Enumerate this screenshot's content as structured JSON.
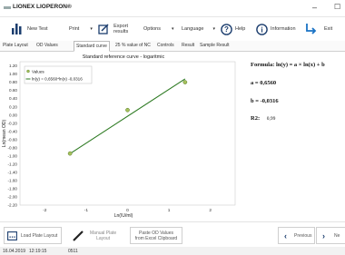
{
  "app": {
    "title": "LIONEX LIOPERON®"
  },
  "window": {
    "minimize_glyph": "–",
    "close_glyph": "☐"
  },
  "toolbar": {
    "new_test": "New Test",
    "print": "Print",
    "export_line1": "Export",
    "export_line2": "results",
    "options": "Options",
    "language": "Language",
    "help": "Help",
    "information": "Information",
    "exit": "Exit"
  },
  "tabs": [
    "Plate Layout",
    "OD Values",
    "Standard curve",
    "25 % value of NC",
    "Controls",
    "Result",
    "Sample Result"
  ],
  "active_tab": 2,
  "chart_data": {
    "type": "scatter",
    "title": "Standard reference curve - logaritmic",
    "xlabel": "Ln(IU/ml)",
    "ylabel": "Ln(mean OD)",
    "xlim": [
      -2.6,
      2.6
    ],
    "ylim": [
      -2.2,
      1.3
    ],
    "xticks": [
      -2,
      -1,
      0,
      1,
      2
    ],
    "yticks": [
      "1.20",
      "1.00",
      "0.80",
      "0.60",
      "0.40",
      "0.20",
      "0.00",
      "-0.20",
      "-0.40",
      "-0.60",
      "-0.80",
      "-1.00",
      "-1.20",
      "-1.40",
      "-1.60",
      "-1.80",
      "-2.00",
      "-2.20"
    ],
    "grid": false,
    "legend": {
      "position": "top-left",
      "entries": [
        "Values",
        "ln(y) = 0,6560*ln(x) -0,0316"
      ]
    },
    "points": [
      {
        "x": -1.39,
        "y": -0.94
      },
      {
        "x": 0.0,
        "y": 0.12
      },
      {
        "x": 1.39,
        "y": 0.8
      }
    ],
    "fit": {
      "a": 0.656,
      "b": -0.0316,
      "x_range": [
        -1.39,
        1.39
      ]
    },
    "colors": {
      "point": "#a6c15b",
      "line": "#2d7a22"
    }
  },
  "results": {
    "formula": "Formula: ln(y) = a × ln(x) + b",
    "a": "a  = 0,6560",
    "b": "b  = -0,0316",
    "r2_label": "R2:",
    "r2_value": "0,99"
  },
  "bottom": {
    "load_plate": "Load Plate Layout",
    "manual_line1": "Manual Plate",
    "manual_line2": "Layout",
    "paste_line1": "Paste OD Values",
    "paste_line2": "from Excel Clipboard",
    "previous": "Previous",
    "next": "Ne"
  },
  "status": {
    "date": "16.04.2019",
    "time": "12:19:15",
    "code": "0511"
  },
  "colors": {
    "accent": "#1a73c5",
    "brand_dark": "#1b3d6e"
  }
}
